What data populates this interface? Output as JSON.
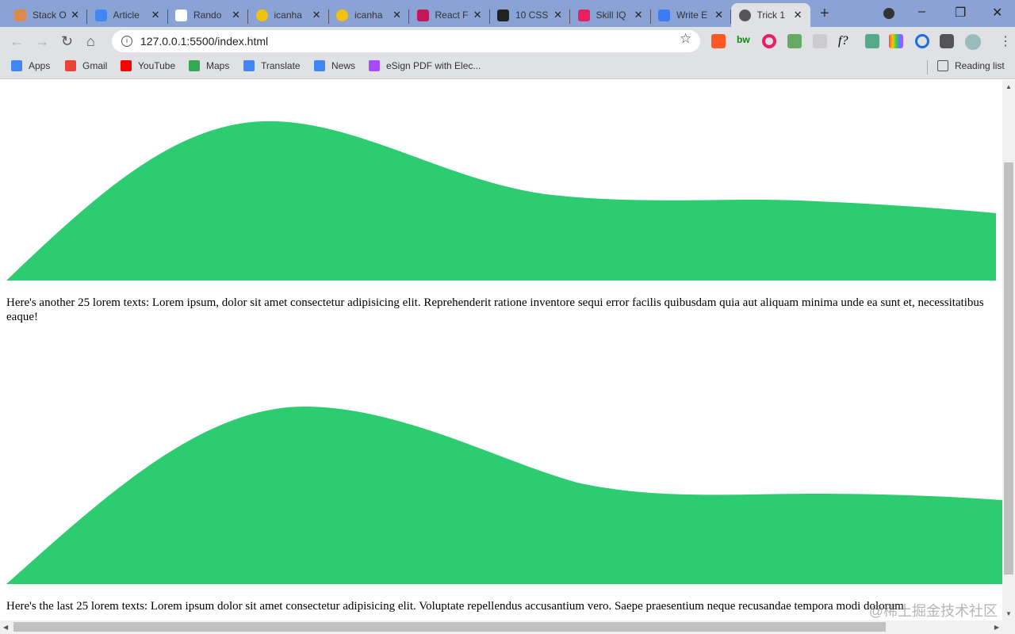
{
  "browser": {
    "tabs": [
      {
        "label": "Stack O",
        "icon": "stackoverflow-icon",
        "color": "#d98b4b"
      },
      {
        "label": "Article",
        "icon": "docs-icon",
        "color": "#4285f4"
      },
      {
        "label": "Rando",
        "icon": "codepen-icon",
        "color": "#ffffff"
      },
      {
        "label": "icanha",
        "icon": "emoji-icon",
        "color": "#f4c20d"
      },
      {
        "label": "icanha",
        "icon": "emoji-icon",
        "color": "#f4c20d"
      },
      {
        "label": "React F",
        "icon": "react-icon",
        "color": "#c2185b"
      },
      {
        "label": "10 CSS",
        "icon": "notion-icon",
        "color": "#222222"
      },
      {
        "label": "Skill IQ",
        "icon": "pluralsight-icon",
        "color": "#e91e63"
      },
      {
        "label": "Write E",
        "icon": "write-icon",
        "color": "#3d7cf5"
      },
      {
        "label": "Trick 1",
        "icon": "globe-icon",
        "color": "#555555",
        "active": true
      }
    ],
    "url": "127.0.0.1:5500/index.html",
    "bookmarks": [
      {
        "label": "Apps",
        "icon": "apps-icon",
        "color": "#4285f4"
      },
      {
        "label": "Gmail",
        "icon": "gmail-icon",
        "color": "#ea4335"
      },
      {
        "label": "YouTube",
        "icon": "youtube-icon",
        "color": "#ff0000"
      },
      {
        "label": "Maps",
        "icon": "maps-icon",
        "color": "#34a853"
      },
      {
        "label": "Translate",
        "icon": "translate-icon",
        "color": "#4285f4"
      },
      {
        "label": "News",
        "icon": "news-icon",
        "color": "#4285f4"
      },
      {
        "label": "eSign PDF with Elec...",
        "icon": "esign-icon",
        "color": "#a64dff"
      }
    ],
    "reading_list": "Reading list"
  },
  "page": {
    "wave_color": "#2ecc71",
    "paragraph1": "Here's another 25 lorem texts: Lorem ipsum, dolor sit amet consectetur adipisicing elit. Reprehenderit ratione inventore sequi error facilis quibusdam quia aut aliquam minima unde ea sunt et, necessitatibus eaque!",
    "paragraph2": "Here's the last 25 lorem texts: Lorem ipsum dolor sit amet consectetur adipisicing elit. Voluptate repellendus accusantium vero. Saepe praesentium neque recusandae tempora modi dolorum"
  },
  "watermark": "@稀土掘金技术社区"
}
